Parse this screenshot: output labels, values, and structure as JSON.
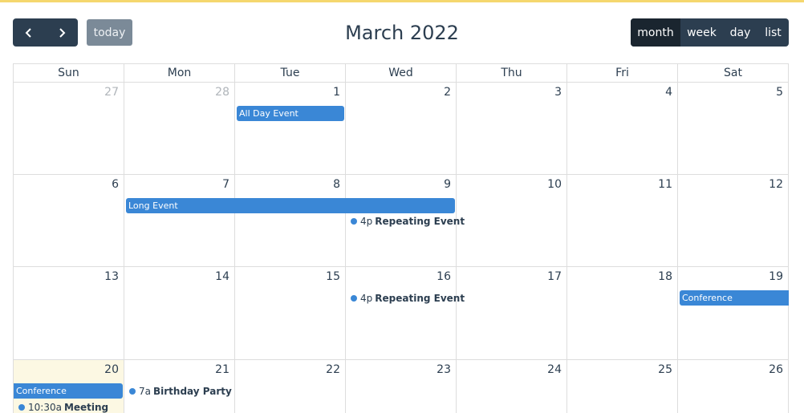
{
  "toolbar": {
    "prev_icon": "chevron-left-icon",
    "next_icon": "chevron-right-icon",
    "today_label": "today",
    "title": "March 2022",
    "views": [
      {
        "label": "month",
        "active": true
      },
      {
        "label": "week",
        "active": false
      },
      {
        "label": "day",
        "active": false
      },
      {
        "label": "list",
        "active": false
      }
    ]
  },
  "weekdays": [
    "Sun",
    "Mon",
    "Tue",
    "Wed",
    "Thu",
    "Fri",
    "Sat"
  ],
  "weeks": [
    {
      "days": [
        {
          "num": "27",
          "other": true
        },
        {
          "num": "28",
          "other": true
        },
        {
          "num": "1"
        },
        {
          "num": "2"
        },
        {
          "num": "3"
        },
        {
          "num": "4"
        },
        {
          "num": "5"
        }
      ]
    },
    {
      "days": [
        {
          "num": "6"
        },
        {
          "num": "7"
        },
        {
          "num": "8"
        },
        {
          "num": "9"
        },
        {
          "num": "10"
        },
        {
          "num": "11"
        },
        {
          "num": "12"
        }
      ]
    },
    {
      "days": [
        {
          "num": "13"
        },
        {
          "num": "14"
        },
        {
          "num": "15"
        },
        {
          "num": "16"
        },
        {
          "num": "17"
        },
        {
          "num": "18"
        },
        {
          "num": "19"
        }
      ]
    },
    {
      "days": [
        {
          "num": "20",
          "today": true
        },
        {
          "num": "21"
        },
        {
          "num": "22"
        },
        {
          "num": "23"
        },
        {
          "num": "24"
        },
        {
          "num": "25"
        },
        {
          "num": "26"
        }
      ]
    }
  ],
  "events": {
    "all_day_event": "All Day Event",
    "long_event": "Long Event",
    "repeating_1": {
      "time": "4p",
      "title": "Repeating Event"
    },
    "repeating_2": {
      "time": "4p",
      "title": "Repeating Event"
    },
    "conference_1": "Conference",
    "conference_2": "Conference",
    "birthday": {
      "time": "7a",
      "title": "Birthday Party"
    },
    "meeting": {
      "time": "10:30a",
      "title": "Meeting"
    }
  },
  "colors": {
    "event": "#3a87d6",
    "accent_top": "#f5d76e",
    "today_bg": "#fcf8e3",
    "button_dark": "#2c3e50",
    "button_today": "#7b8a98"
  }
}
